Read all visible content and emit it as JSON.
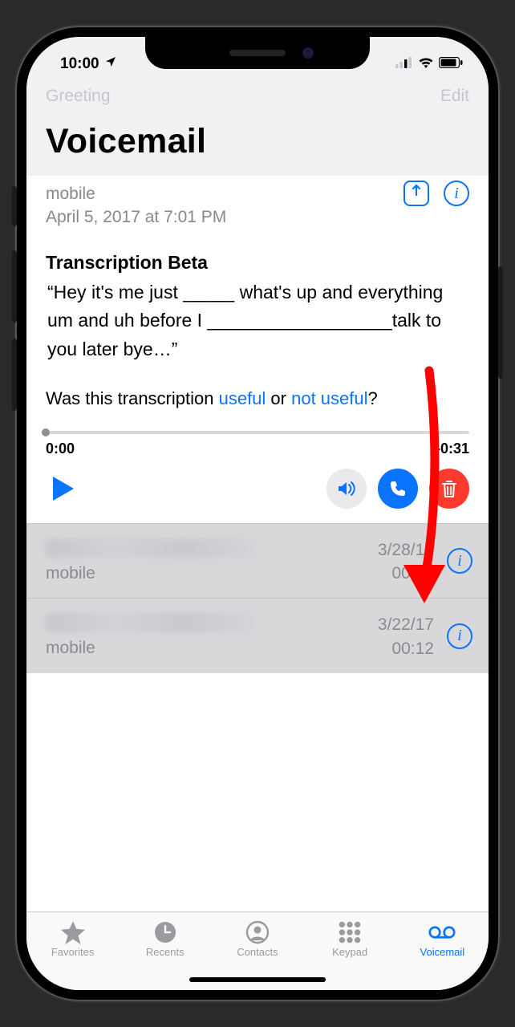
{
  "status": {
    "time": "10:00",
    "location_icon": "location-arrow"
  },
  "header": {
    "left_button": "Greeting",
    "right_button": "Edit",
    "title": "Voicemail"
  },
  "expanded": {
    "phone_type": "mobile",
    "datetime": "April 5, 2017 at 7:01 PM",
    "transcription_title": "Transcription Beta",
    "transcription_body": "“Hey it's me just _____ what's up and everything um and uh before I __________________talk to you later bye…”",
    "feedback_prefix": "Was this transcription ",
    "feedback_useful": "useful",
    "feedback_or": " or ",
    "feedback_not_useful": "not useful",
    "feedback_q": "?",
    "time_start": "0:00",
    "time_remain": "–0:31"
  },
  "rows": [
    {
      "phone_type": "mobile",
      "date": "3/28/17",
      "duration": "00:05"
    },
    {
      "phone_type": "mobile",
      "date": "3/22/17",
      "duration": "00:12"
    }
  ],
  "tabs": {
    "favorites": "Favorites",
    "recents": "Recents",
    "contacts": "Contacts",
    "keypad": "Keypad",
    "voicemail": "Voicemail"
  }
}
